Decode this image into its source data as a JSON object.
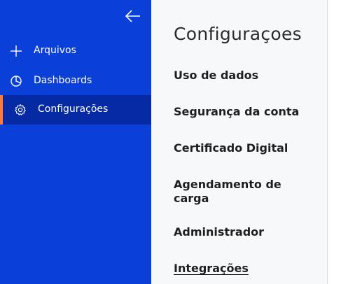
{
  "sidebar": {
    "items": [
      {
        "label": "Arquivos",
        "icon": "plus-icon"
      },
      {
        "label": "Dashboards",
        "icon": "pie-chart-icon"
      },
      {
        "label": "Configurações",
        "icon": "gear-icon",
        "active": true
      }
    ],
    "colors": {
      "background": "#0a3fd8",
      "active_background": "#052aa3",
      "active_accent": "#ff7a3d"
    }
  },
  "main": {
    "title": "Configuraçoes",
    "links": [
      {
        "label": "Uso de dados"
      },
      {
        "label": "Segurança da conta"
      },
      {
        "label": "Certificado Digital"
      },
      {
        "label": "Agendamento de carga"
      },
      {
        "label": "Administrador"
      },
      {
        "label": "Integrações"
      }
    ]
  }
}
